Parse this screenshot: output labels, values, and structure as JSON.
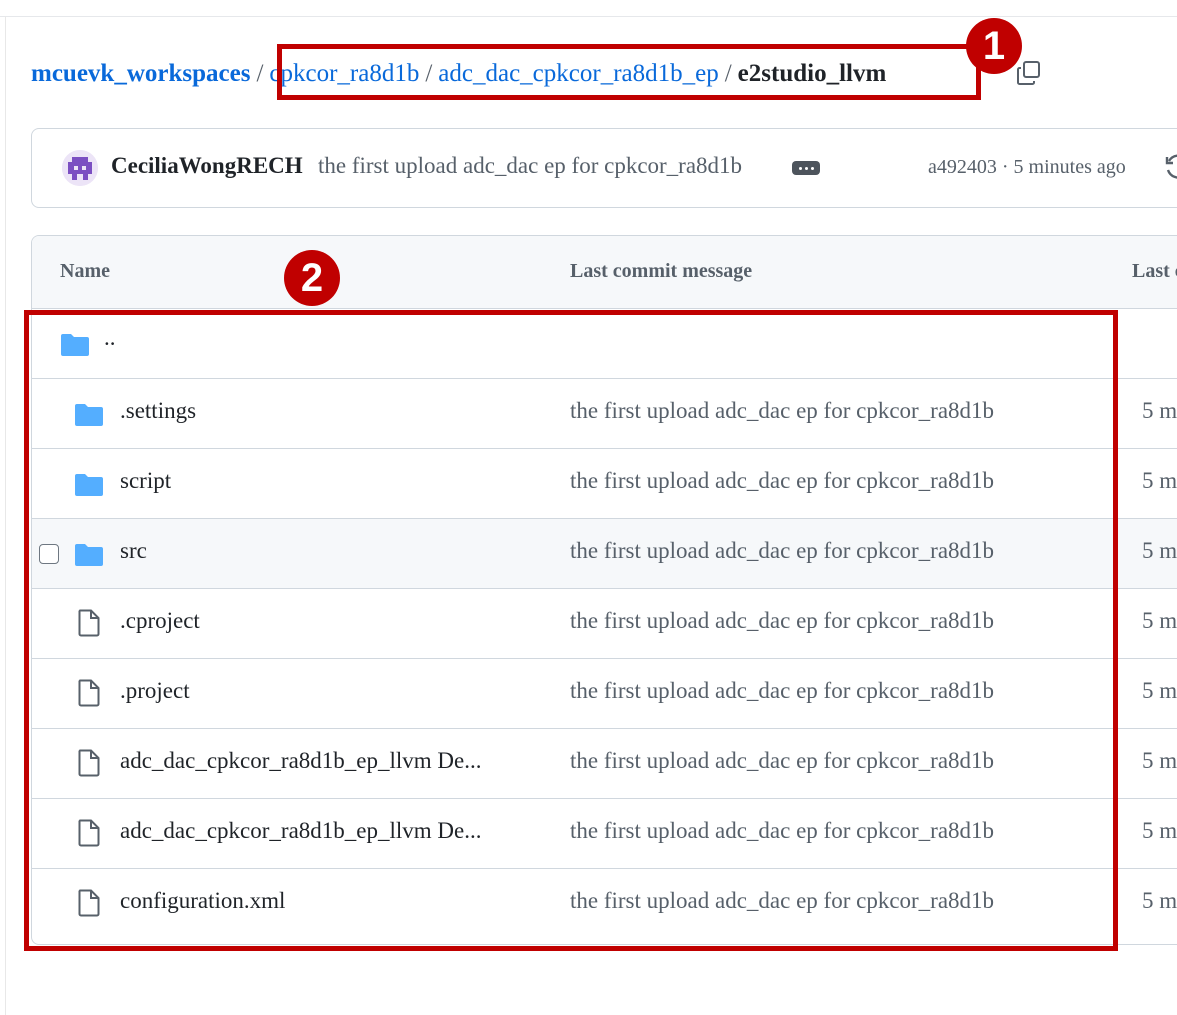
{
  "breadcrumb": {
    "root": "mcuevk_workspaces",
    "separator": "/",
    "items": [
      "cpkcor_ra8d1b",
      "adc_dac_cpkcor_ra8d1b_ep"
    ],
    "current": "e2studio_llvm"
  },
  "copy_path_icon": "copy-icon",
  "annotations": {
    "badge_1": "1",
    "badge_2": "2",
    "color": "#c00000"
  },
  "commit": {
    "author": "CeciliaWongRECH",
    "message": "the first upload adc_dac ep for cpkcor_ra8d1b",
    "hash_time": "a492403 · 5 minutes ago"
  },
  "table": {
    "headers": {
      "name": "Name",
      "message": "Last commit message",
      "date": "Last c"
    },
    "parent_dir": "..",
    "rows": [
      {
        "type": "folder",
        "name": ".settings",
        "message": "the first upload adc_dac ep for cpkcor_ra8d1b",
        "time": "5 m"
      },
      {
        "type": "folder",
        "name": "script",
        "message": "the first upload adc_dac ep for cpkcor_ra8d1b",
        "time": "5 m"
      },
      {
        "type": "folder",
        "name": "src",
        "message": "the first upload adc_dac ep for cpkcor_ra8d1b",
        "time": "5 m"
      },
      {
        "type": "file",
        "name": ".cproject",
        "message": "the first upload adc_dac ep for cpkcor_ra8d1b",
        "time": "5 m"
      },
      {
        "type": "file",
        "name": ".project",
        "message": "the first upload adc_dac ep for cpkcor_ra8d1b",
        "time": "5 m"
      },
      {
        "type": "file",
        "name": "adc_dac_cpkcor_ra8d1b_ep_llvm De...",
        "message": "the first upload adc_dac ep for cpkcor_ra8d1b",
        "time": "5 m"
      },
      {
        "type": "file",
        "name": "adc_dac_cpkcor_ra8d1b_ep_llvm De...",
        "message": "the first upload adc_dac ep for cpkcor_ra8d1b",
        "time": "5 m"
      },
      {
        "type": "file",
        "name": "configuration.xml",
        "message": "the first upload adc_dac ep for cpkcor_ra8d1b",
        "time": "5 m"
      }
    ]
  },
  "colors": {
    "link": "#0969da",
    "folder": "#54aeff",
    "annotation": "#c00000"
  }
}
